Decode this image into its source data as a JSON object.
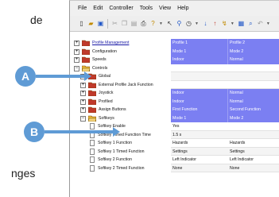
{
  "left_text": {
    "top": "de",
    "bottom": "nges"
  },
  "menu": [
    "File",
    "Edit",
    "Controller",
    "Tools",
    "View",
    "Help"
  ],
  "toolbar_icons": [
    "new-doc",
    "open-folder",
    "save",
    "cut",
    "copy",
    "paste",
    "print",
    "help",
    "pointer",
    "search",
    "refresh",
    "download",
    "upload",
    "chart",
    "grid",
    "find",
    "undo",
    "more"
  ],
  "callouts": {
    "a": "A",
    "b": "B"
  },
  "tree": [
    {
      "label": "Profile Management",
      "level": 0,
      "expander": "+",
      "icon": "red-folder",
      "link": true,
      "values": [
        "Profile 1",
        "Profile 2"
      ],
      "style": "hl"
    },
    {
      "label": "Configuration",
      "level": 0,
      "expander": "+",
      "icon": "red-folder",
      "values": [
        "Mode 1",
        "Mode 2"
      ],
      "style": "hl"
    },
    {
      "label": "Speeds",
      "level": 0,
      "expander": "+",
      "icon": "red-folder",
      "values": [
        "Indoor",
        "Normal"
      ],
      "style": "hl"
    },
    {
      "label": "Controls",
      "level": 0,
      "expander": "−",
      "icon": "open-folder",
      "values": [
        "",
        ""
      ],
      "style": "plain"
    },
    {
      "label": "Global",
      "level": 1,
      "expander": "+",
      "icon": "red-folder",
      "values": [
        "",
        ""
      ],
      "style": "stripe"
    },
    {
      "label": "External Profile Jack Function",
      "level": 1,
      "expander": "+",
      "icon": "red-folder",
      "values": [
        "",
        ""
      ],
      "style": "plain"
    },
    {
      "label": "Joystick",
      "level": 1,
      "expander": "+",
      "icon": "red-folder",
      "values": [
        "Indoor",
        "Normal"
      ],
      "style": "hl"
    },
    {
      "label": "Profiled",
      "level": 1,
      "expander": "+",
      "icon": "red-folder",
      "values": [
        "Indoor",
        "Normal"
      ],
      "style": "hl"
    },
    {
      "label": "Assign Buttons",
      "level": 1,
      "expander": "+",
      "icon": "red-folder",
      "values": [
        "First Function",
        "Second Function"
      ],
      "style": "hl"
    },
    {
      "label": "Softkeys",
      "level": 1,
      "expander": "−",
      "icon": "open-folder",
      "values": [
        "Mode 1",
        "Mode 2"
      ],
      "style": "hl"
    },
    {
      "label": "Softkey Enable",
      "level": 2,
      "icon": "doc",
      "values": [
        "Yes",
        ""
      ],
      "style": "plain"
    },
    {
      "label": "Softkey Timed Function Time",
      "level": 2,
      "icon": "doc",
      "values": [
        "1.5 s",
        ""
      ],
      "style": "stripe"
    },
    {
      "label": "Softkey 1 Function",
      "level": 2,
      "icon": "doc",
      "values": [
        "Hazards",
        "Hazards"
      ],
      "style": "plain"
    },
    {
      "label": "Softkey 1 Timed Function",
      "level": 2,
      "icon": "doc",
      "values": [
        "Settings",
        "Settings"
      ],
      "style": "stripe"
    },
    {
      "label": "Softkey 2 Function",
      "level": 2,
      "icon": "doc",
      "values": [
        "Left Indicator",
        "Left Indicator"
      ],
      "style": "plain"
    },
    {
      "label": "Softkey 2 Timed Function",
      "level": 2,
      "icon": "doc",
      "values": [
        "None",
        "None"
      ],
      "style": "stripe"
    }
  ],
  "colors": {
    "highlight": "#7b7ff2",
    "callout": "#5f9bd5",
    "folder_red": "#c0392b",
    "folder_gold": "#e8b93a"
  }
}
